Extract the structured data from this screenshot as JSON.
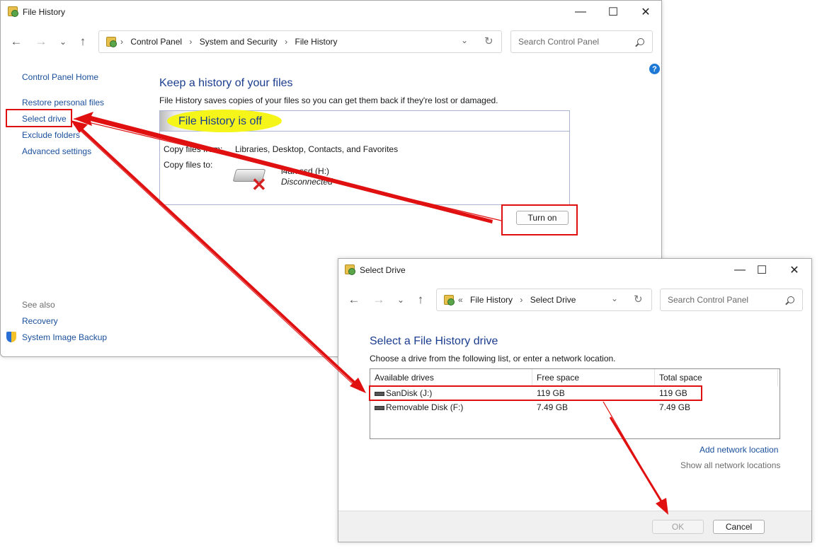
{
  "main_window": {
    "title": "File History",
    "controls": {
      "minimize": "—",
      "maximize": "☐",
      "close": "✕"
    },
    "breadcrumbs": [
      "Control Panel",
      "System and Security",
      "File History"
    ],
    "search_placeholder": "Search Control Panel",
    "sidebar": {
      "home": "Control Panel Home",
      "items": [
        "Restore personal files",
        "Select drive",
        "Exclude folders",
        "Advanced settings"
      ],
      "see_also_label": "See also",
      "see_also": [
        "Recovery",
        "System Image Backup"
      ]
    },
    "heading": "Keep a history of your files",
    "description": "File History saves copies of your files so you can get them back if they're lost or damaged.",
    "status": "File History is off",
    "copy_from_label": "Copy files from:",
    "copy_from_value": "Libraries, Desktop, Contacts, and Favorites",
    "copy_to_label": "Copy files to:",
    "drive_name": "i4an ssd (H:)",
    "drive_status": "Disconnected",
    "turn_on_button": "Turn on"
  },
  "dialog": {
    "title": "Select Drive",
    "controls": {
      "minimize": "—",
      "maximize": "☐",
      "close": "✕"
    },
    "breadcrumbs": [
      "File History",
      "Select Drive"
    ],
    "search_placeholder": "Search Control Panel",
    "heading": "Select a File History drive",
    "description": "Choose a drive from the following list, or enter a network location.",
    "table": {
      "columns": [
        "Available drives",
        "Free space",
        "Total space"
      ],
      "rows": [
        [
          "SanDisk (J:)",
          "119 GB",
          "119 GB"
        ],
        [
          "Removable Disk (F:)",
          "7.49 GB",
          "7.49 GB"
        ]
      ]
    },
    "add_network_location": "Add network location",
    "show_all_network_locations": "Show all network locations",
    "ok_button": "OK",
    "cancel_button": "Cancel"
  },
  "colors": {
    "link": "#1a4f9c",
    "heading": "#1b3d8f",
    "annotation_red": "#e01010",
    "highlight_yellow": "#f5f51a"
  },
  "icons": [
    "file-history-icon",
    "back-arrow-icon",
    "forward-arrow-icon",
    "recent-dropdown-icon",
    "up-arrow-icon",
    "refresh-icon",
    "search-icon",
    "help-icon",
    "shield-icon",
    "drive-disconnected-icon",
    "usb-drive-icon"
  ]
}
